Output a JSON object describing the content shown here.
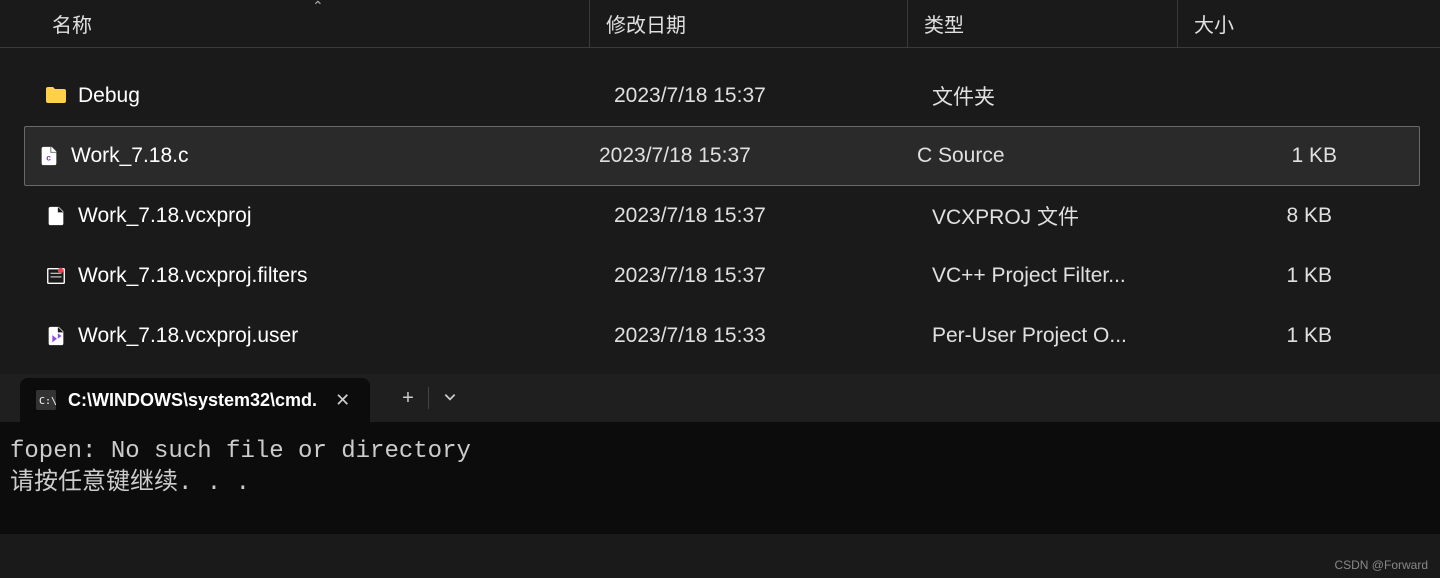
{
  "explorer": {
    "columns": {
      "name": "名称",
      "date": "修改日期",
      "type": "类型",
      "size": "大小"
    },
    "rows": [
      {
        "icon": "folder",
        "name": "Debug",
        "date": "2023/7/18 15:37",
        "type": "文件夹",
        "size": "",
        "selected": false
      },
      {
        "icon": "c-file",
        "name": "Work_7.18.c",
        "date": "2023/7/18 15:37",
        "type": "C Source",
        "size": "1 KB",
        "selected": true
      },
      {
        "icon": "file",
        "name": "Work_7.18.vcxproj",
        "date": "2023/7/18 15:37",
        "type": "VCXPROJ 文件",
        "size": "8 KB",
        "selected": false
      },
      {
        "icon": "filters",
        "name": "Work_7.18.vcxproj.filters",
        "date": "2023/7/18 15:37",
        "type": "VC++ Project Filter...",
        "size": "1 KB",
        "selected": false
      },
      {
        "icon": "vs-file",
        "name": "Work_7.18.vcxproj.user",
        "date": "2023/7/18 15:33",
        "type": "Per-User Project O...",
        "size": "1 KB",
        "selected": false
      }
    ]
  },
  "terminal": {
    "tab_title": "C:\\WINDOWS\\system32\\cmd.",
    "output_line1": "fopen: No such file or directory",
    "output_line2": "请按任意键继续. . ."
  },
  "watermark": "CSDN @Forward"
}
